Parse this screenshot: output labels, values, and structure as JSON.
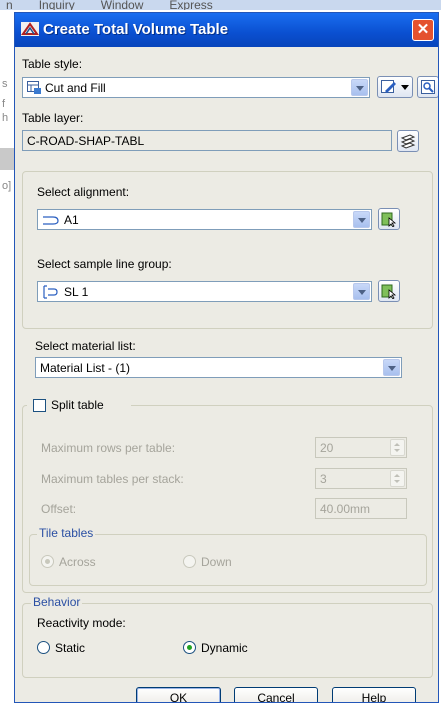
{
  "background": {
    "menu_items": [
      "n",
      "Inquiry",
      "Window",
      "Express"
    ],
    "left_chars": [
      "s",
      "f",
      "h",
      "o]"
    ]
  },
  "dialog": {
    "title": "Create Total Volume Table",
    "close_symbol": "✕"
  },
  "table_style": {
    "label": "Table style:",
    "value": "Cut and Fill"
  },
  "table_layer": {
    "label": "Table layer:",
    "value": "C-ROAD-SHAP-TABL"
  },
  "alignment": {
    "label": "Select alignment:",
    "value": "A1"
  },
  "sample_line_group": {
    "label": "Select sample line group:",
    "value": "SL 1"
  },
  "material_list": {
    "label": "Select material list:",
    "value": "Material List - (1)"
  },
  "split_table": {
    "label": "Split table",
    "checked": false,
    "max_rows_label": "Maximum rows per table:",
    "max_rows_value": "20",
    "max_tables_label": "Maximum tables per stack:",
    "max_tables_value": "3",
    "offset_label": "Offset:",
    "offset_value": "40.00mm",
    "tile_tables_label": "Tile tables",
    "across_label": "Across",
    "down_label": "Down",
    "tile_selected": "Across"
  },
  "behavior": {
    "group_label": "Behavior",
    "reactivity_label": "Reactivity mode:",
    "static_label": "Static",
    "dynamic_label": "Dynamic",
    "selected": "Dynamic"
  },
  "buttons": {
    "ok": "OK",
    "cancel": "Cancel",
    "help": "Help"
  }
}
